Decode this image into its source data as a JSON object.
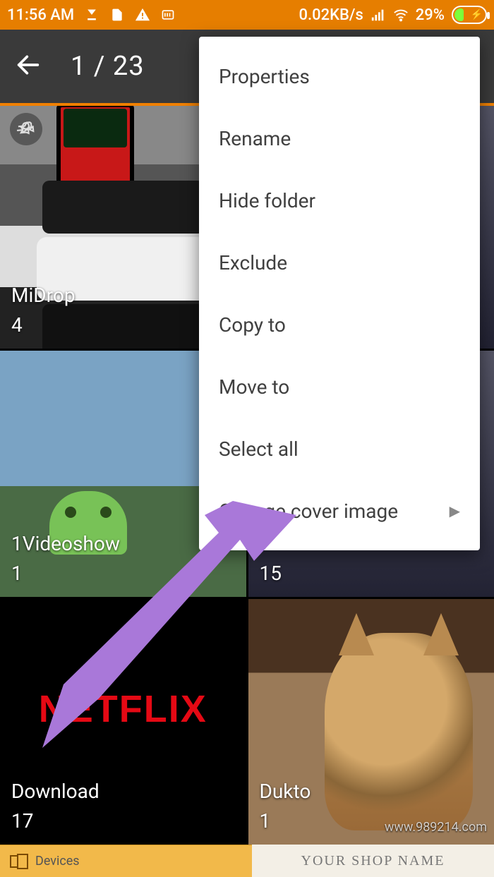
{
  "status": {
    "time": "11:56 AM",
    "data_rate": "0.02KB/s",
    "battery_pct": "29%"
  },
  "appbar": {
    "counter": "1 / 23"
  },
  "menu": {
    "items": [
      {
        "label": "Properties",
        "has_submenu": false
      },
      {
        "label": "Rename",
        "has_submenu": false
      },
      {
        "label": "Hide folder",
        "has_submenu": false
      },
      {
        "label": "Exclude",
        "has_submenu": false
      },
      {
        "label": "Copy to",
        "has_submenu": false
      },
      {
        "label": "Move to",
        "has_submenu": false
      },
      {
        "label": "Select all",
        "has_submenu": false
      },
      {
        "label": "Change cover image",
        "has_submenu": true
      }
    ]
  },
  "folders": [
    {
      "name": "MiDrop",
      "count": "4",
      "pinned": true
    },
    {
      "name": "",
      "count": "",
      "pinned": false
    },
    {
      "name": "1Videoshow",
      "count": "1",
      "pinned": false
    },
    {
      "name": "",
      "count": "15",
      "pinned": false
    },
    {
      "name": "Download",
      "count": "17",
      "pinned": false
    },
    {
      "name": "Dukto",
      "count": "1",
      "pinned": false
    }
  ],
  "bottom": {
    "devices": "Devices",
    "shop": "YOUR SHOP NAME"
  },
  "watermark": "www.989214.com",
  "thumbs": {
    "netflix": "NETFLIX"
  }
}
